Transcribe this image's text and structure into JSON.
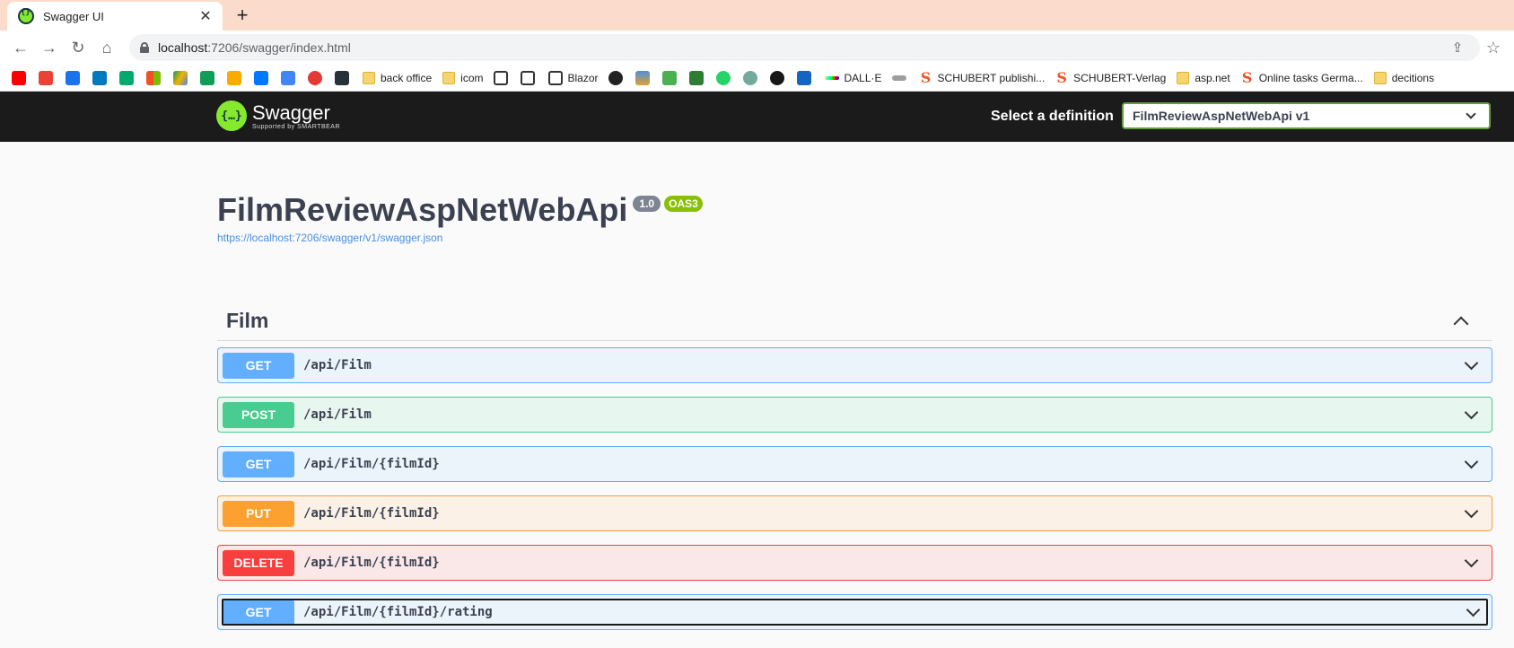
{
  "browser": {
    "tab_title": "Swagger UI",
    "tab_close": "✕",
    "new_tab": "+",
    "url_host": "localhost",
    "url_path": ":7206/swagger/index.html",
    "bookmarks": [
      {
        "label": "back office",
        "icon": "folder-icon"
      },
      {
        "label": "icom",
        "icon": "folder-icon"
      },
      {
        "label": "Blazor",
        "icon": "medium-icon"
      },
      {
        "label": "DALL·E",
        "icon": "dalle-icon"
      },
      {
        "label": "SCHUBERT publishi...",
        "icon": "schubert-icon"
      },
      {
        "label": "SCHUBERT-Verlag",
        "icon": "schubert-icon"
      },
      {
        "label": "asp.net",
        "icon": "folder-icon"
      },
      {
        "label": "Online tasks Germa...",
        "icon": "schubert-icon"
      },
      {
        "label": "decitions",
        "icon": "folder-icon"
      }
    ]
  },
  "topbar": {
    "logo_text": "Swagger",
    "logo_sub": "Supported by SMARTBEAR",
    "definition_label": "Select a definition",
    "definition_value": "FilmReviewAspNetWebApi v1"
  },
  "info": {
    "title": "FilmReviewAspNetWebApi",
    "version": "1.0",
    "oas": "OAS3",
    "spec_url": "https://localhost:7206/swagger/v1/swagger.json"
  },
  "tag": {
    "name": "Film"
  },
  "operations": [
    {
      "method": "GET",
      "path": "/api/Film"
    },
    {
      "method": "POST",
      "path": "/api/Film"
    },
    {
      "method": "GET",
      "path": "/api/Film/{filmId}"
    },
    {
      "method": "PUT",
      "path": "/api/Film/{filmId}"
    },
    {
      "method": "DELETE",
      "path": "/api/Film/{filmId}"
    },
    {
      "method": "GET",
      "path": "/api/Film/{filmId}/rating"
    }
  ],
  "colors": {
    "get": "#61affe",
    "post": "#49cc90",
    "put": "#fca130",
    "delete": "#f93e3e",
    "swagger_green": "#85ea2d",
    "topbar": "#1b1b1b"
  }
}
